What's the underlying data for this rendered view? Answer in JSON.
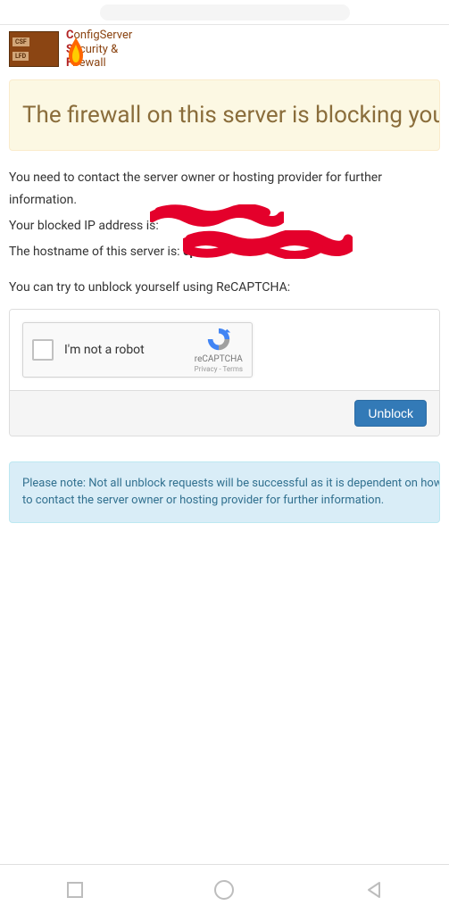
{
  "logo": {
    "brick_top": "CSF",
    "brick_bottom": "LFD",
    "line1_letter": "C",
    "line1_rest": "onfigServer",
    "line2_letter": "S",
    "line2_rest": "ecurity &",
    "line3_letter": "F",
    "line3_rest": "irewall"
  },
  "alert": {
    "heading": "The firewall on this server is blocking you"
  },
  "info": {
    "contact": "You need to contact the server owner or hosting provider for further information.",
    "ip_label": "Your blocked IP address is:",
    "hostname_label": "The hostname of this server is:",
    "hostname_prefix": "cp"
  },
  "recaptcha": {
    "intro": "You can try to unblock yourself using ReCAPTCHA:",
    "checkbox_label": "I'm not a robot",
    "brand": "reCAPTCHA",
    "terms": "Privacy - Terms"
  },
  "actions": {
    "unblock": "Unblock"
  },
  "note": {
    "line1": "Please note: Not all unblock requests will be successful as it is dependent on how your IP",
    "line2": "to contact the server owner or hosting provider for further information."
  }
}
